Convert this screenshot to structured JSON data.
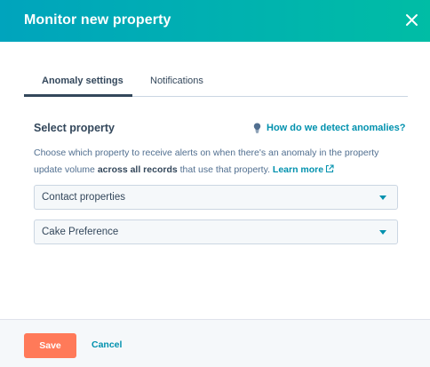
{
  "modal": {
    "title": "Monitor new property"
  },
  "tabs": [
    {
      "label": "Anomaly settings",
      "active": true
    },
    {
      "label": "Notifications",
      "active": false
    }
  ],
  "section": {
    "title": "Select property",
    "help_link": "How do we detect anomalies?",
    "description_part1": "Choose which property to receive alerts on when there's an anomaly in the property update volume ",
    "description_bold": "across all records",
    "description_part2": " that use that property. ",
    "learn_more": "Learn more"
  },
  "selects": [
    {
      "value": "Contact properties"
    },
    {
      "value": "Cake Preference"
    }
  ],
  "footer": {
    "save_label": "Save",
    "cancel_label": "Cancel"
  },
  "colors": {
    "header_start": "#00a4bd",
    "header_end": "#00bda5",
    "link": "#0091ae",
    "primary_button": "#ff7a59",
    "text": "#33475b"
  },
  "icons": [
    "close-icon",
    "lightbulb-icon",
    "external-link-icon",
    "chevron-down-icon"
  ]
}
